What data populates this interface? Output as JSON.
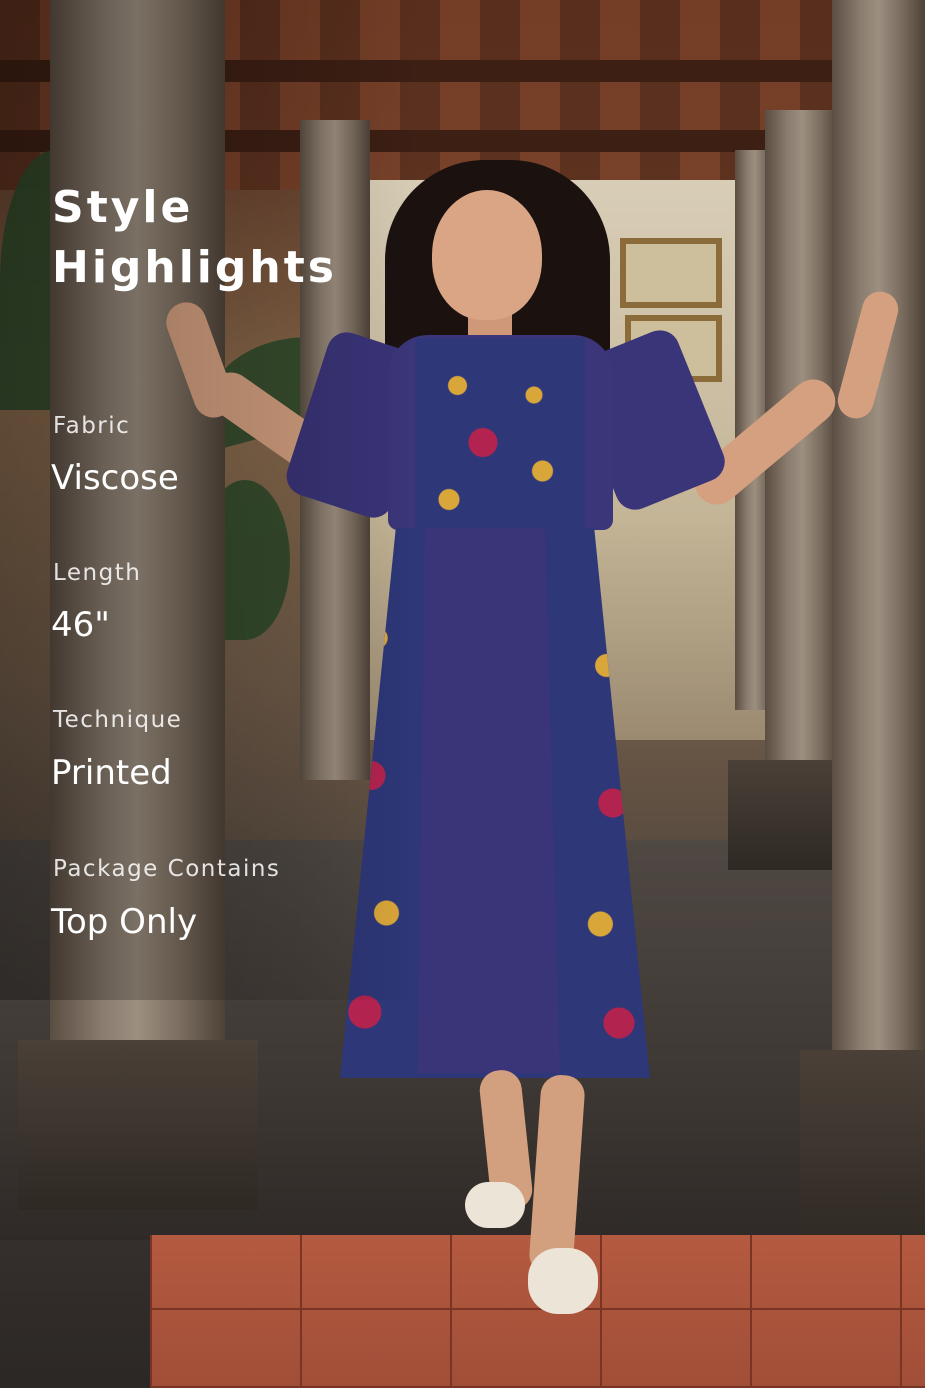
{
  "heading": {
    "line1": "Style",
    "line2": "Highlights"
  },
  "specs": [
    {
      "label": "Fabric",
      "value": "Viscose"
    },
    {
      "label": "Length",
      "value": "46\""
    },
    {
      "label": "Technique",
      "value": "Printed"
    },
    {
      "label": "Package Contains",
      "value": "Top Only"
    }
  ],
  "colors": {
    "dress": "#3a3478",
    "print_red": "#b3234f",
    "print_gold": "#d9a63a",
    "floor_tile": "#b45a40",
    "text": "#ffffff"
  }
}
